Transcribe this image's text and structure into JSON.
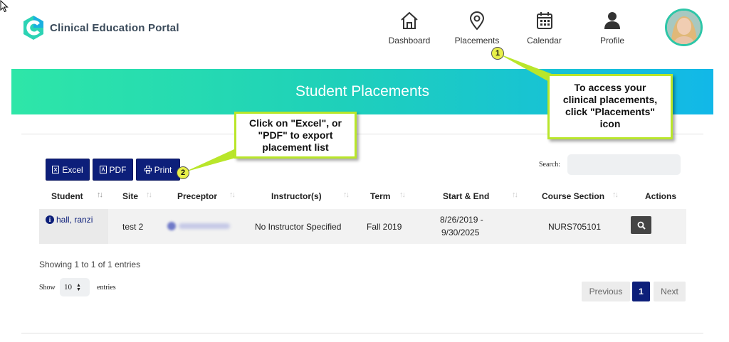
{
  "app": {
    "title": "Clinical Education Portal"
  },
  "nav": [
    {
      "label": "Dashboard",
      "icon": "home-icon"
    },
    {
      "label": "Placements",
      "icon": "map-pin-icon"
    },
    {
      "label": "Calendar",
      "icon": "calendar-icon"
    },
    {
      "label": "Profile",
      "icon": "user-icon"
    }
  ],
  "banner": {
    "title": "Student Placements"
  },
  "toolbar": {
    "excel_label": "Excel",
    "pdf_label": "PDF",
    "print_label": "Print"
  },
  "search": {
    "label": "Search:",
    "placeholder": ""
  },
  "table": {
    "headers": [
      "Student",
      "Site",
      "Preceptor",
      "Instructor(s)",
      "Term",
      "Start & End",
      "Course Section",
      "Actions"
    ],
    "rows": [
      {
        "student": "hall, ranzi",
        "site": "test 2",
        "preceptor": "",
        "instructor": "No Instructor Specified",
        "term": "Fall 2019",
        "start_end_line1": "8/26/2019 -",
        "start_end_line2": "9/30/2025",
        "course_section": "NURS705101"
      }
    ]
  },
  "footer": {
    "info": "Showing 1 to 1 of 1 entries",
    "show_label": "Show",
    "page_size": "10",
    "entries_label": "entries"
  },
  "pagination": {
    "previous": "Previous",
    "current": "1",
    "next": "Next"
  },
  "callouts": [
    {
      "number": "1",
      "lines": [
        "To access your",
        "clinical placements,",
        "click \"Placements\"",
        "icon"
      ]
    },
    {
      "number": "2",
      "lines": [
        "Click on \"Excel\", or",
        "\"PDF\" to export",
        "placement list"
      ]
    }
  ],
  "colors": {
    "accent": "#0d1f7a",
    "banner_start": "#2ee6a8",
    "banner_end": "#12b8e8",
    "callout_border": "#b9e62a"
  }
}
